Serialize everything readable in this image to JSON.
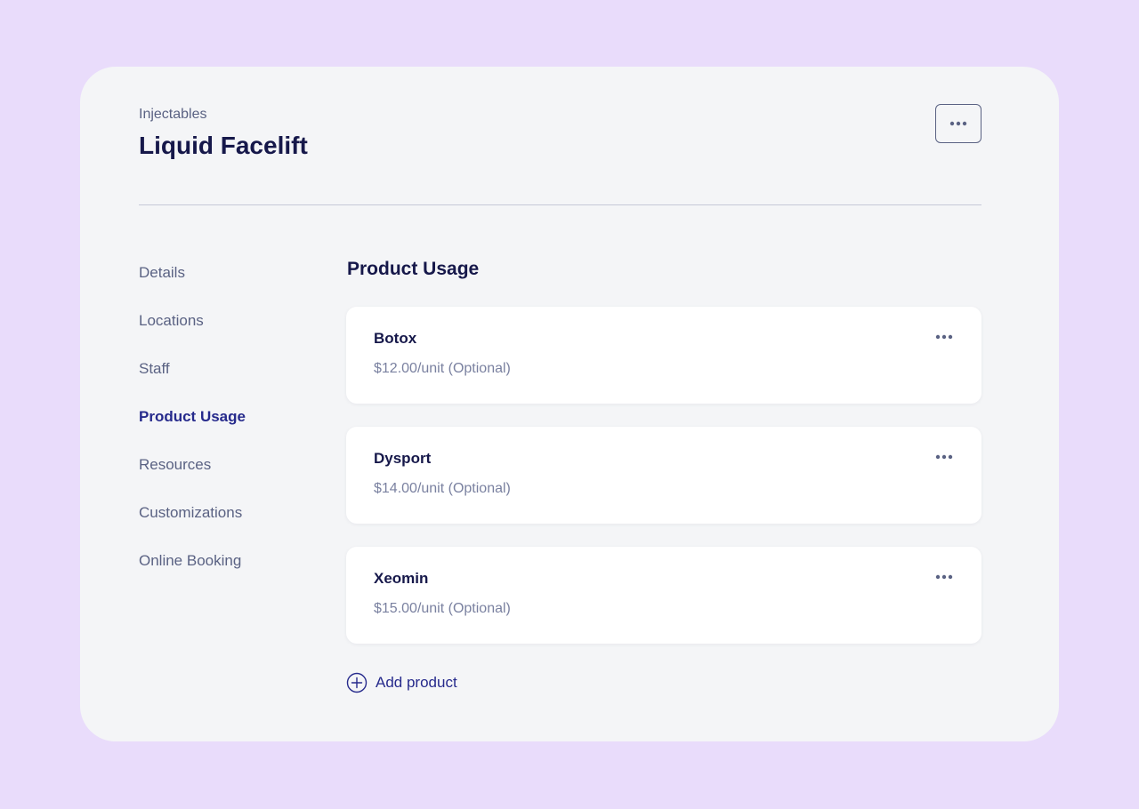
{
  "header": {
    "category": "Injectables",
    "title": "Liquid Facelift",
    "menu_icon": "more-horizontal-icon"
  },
  "nav": {
    "items": [
      {
        "label": "Details",
        "active": false
      },
      {
        "label": "Locations",
        "active": false
      },
      {
        "label": "Staff",
        "active": false
      },
      {
        "label": "Product Usage",
        "active": true
      },
      {
        "label": "Resources",
        "active": false
      },
      {
        "label": "Customizations",
        "active": false
      },
      {
        "label": "Online Booking",
        "active": false
      }
    ]
  },
  "main": {
    "section_title": "Product Usage",
    "products": [
      {
        "name": "Botox",
        "price": "$12.00/unit (Optional)"
      },
      {
        "name": "Dysport",
        "price": "$14.00/unit (Optional)"
      },
      {
        "name": "Xeomin",
        "price": "$15.00/unit (Optional)"
      }
    ],
    "add_product_label": "Add product",
    "add_icon": "plus-circle-icon"
  },
  "colors": {
    "background": "#e9dcfb",
    "card": "#f4f5f7",
    "accent": "#262a8c",
    "heading": "#16184a",
    "muted": "#5a6283"
  }
}
